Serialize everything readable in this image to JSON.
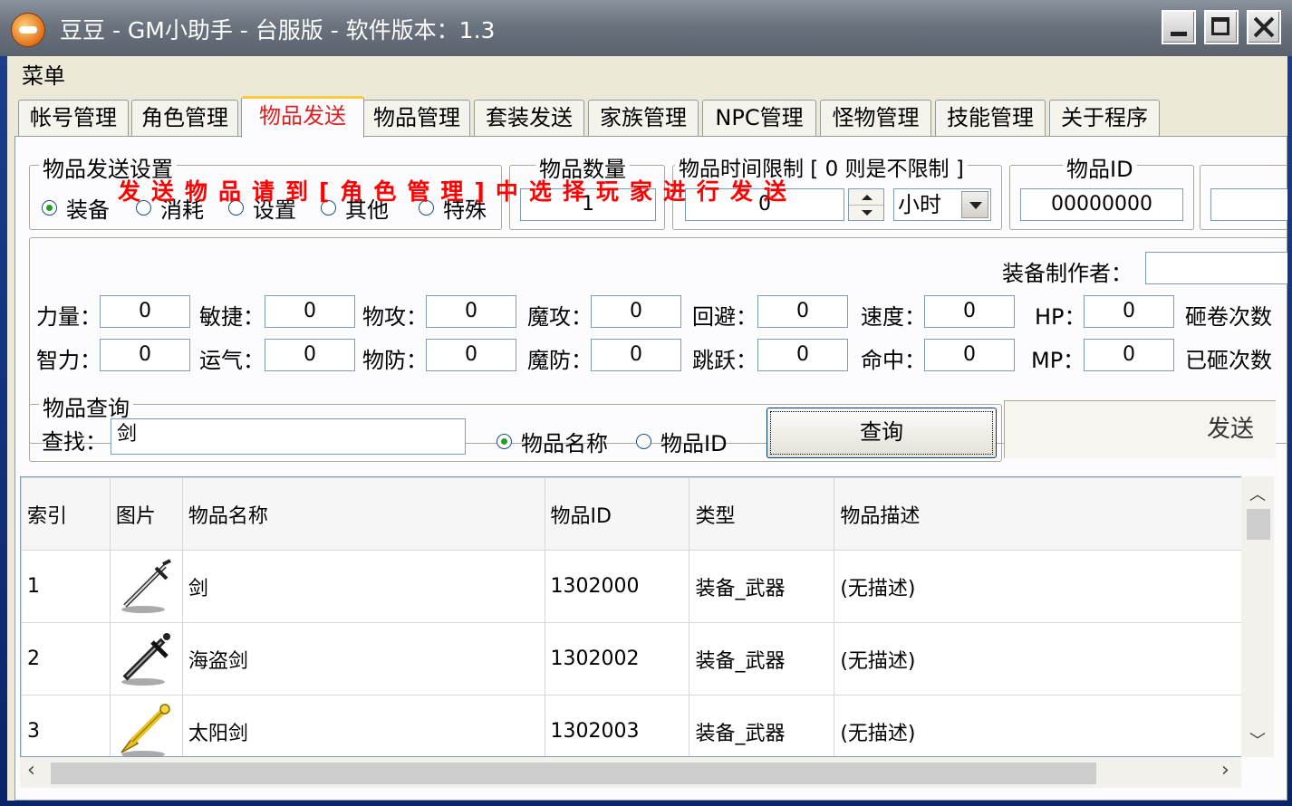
{
  "window": {
    "title": "豆豆 - GM小助手 - 台服版 - 软件版本：1.3"
  },
  "menu": {
    "label": "菜单"
  },
  "tabs": [
    {
      "label": "帐号管理"
    },
    {
      "label": "角色管理"
    },
    {
      "label": "物品发送",
      "active": true
    },
    {
      "label": "物品管理"
    },
    {
      "label": "套装发送"
    },
    {
      "label": "家族管理"
    },
    {
      "label": "NPC管理"
    },
    {
      "label": "怪物管理"
    },
    {
      "label": "技能管理"
    },
    {
      "label": "关于程序"
    }
  ],
  "send_settings": {
    "title": "物品发送设置",
    "options": [
      {
        "label": "装备",
        "selected": true
      },
      {
        "label": "消耗"
      },
      {
        "label": "设置"
      },
      {
        "label": "其他"
      },
      {
        "label": "特殊"
      }
    ]
  },
  "quantity": {
    "title": "物品数量",
    "value": "1"
  },
  "time_limit": {
    "title": "物品时间限制 [ 0 则是不限制 ]",
    "value": "0",
    "unit": "小时"
  },
  "item_id": {
    "title": "物品ID",
    "value": "00000000"
  },
  "notice": "发送物品请到[角色管理]中选择玩家进行发送",
  "maker": {
    "label": "装备制作者：",
    "value": ""
  },
  "stats_row1": [
    {
      "label": "力量：",
      "value": "0"
    },
    {
      "label": "敏捷：",
      "value": "0"
    },
    {
      "label": "物攻：",
      "value": "0"
    },
    {
      "label": "魔攻：",
      "value": "0"
    },
    {
      "label": "回避：",
      "value": "0"
    },
    {
      "label": "速度：",
      "value": "0"
    },
    {
      "label": "HP：",
      "value": "0"
    }
  ],
  "stats_row2": [
    {
      "label": "智力：",
      "value": "0"
    },
    {
      "label": "运气：",
      "value": "0"
    },
    {
      "label": "物防：",
      "value": "0"
    },
    {
      "label": "魔防：",
      "value": "0"
    },
    {
      "label": "跳跃：",
      "value": "0"
    },
    {
      "label": "命中：",
      "value": "0"
    },
    {
      "label": "MP：",
      "value": "0"
    }
  ],
  "extra_labels": {
    "upgrade": "砸卷次数",
    "upgraded": "已砸次数"
  },
  "query": {
    "title": "物品查询",
    "find_label": "查找：",
    "value": "剑",
    "mode_name": "物品名称",
    "mode_id": "物品ID",
    "button": "查询"
  },
  "send_button": "发送",
  "table": {
    "columns": [
      "索引",
      "图片",
      "物品名称",
      "物品ID",
      "类型",
      "物品描述"
    ],
    "rows": [
      {
        "index": "1",
        "icon": "sword-icon",
        "name": "剑",
        "id": "1302000",
        "type": "装备_武器",
        "desc": "(无描述)"
      },
      {
        "index": "2",
        "icon": "pirate-sword-icon",
        "name": "海盗剑",
        "id": "1302002",
        "type": "装备_武器",
        "desc": "(无描述)"
      },
      {
        "index": "3",
        "icon": "sun-sword-icon",
        "name": "太阳剑",
        "id": "1302003",
        "type": "装备_武器",
        "desc": "(无描述)"
      }
    ]
  },
  "colors": {
    "notice": "#ff0000",
    "active_tab_text": "#e02020",
    "tab_highlight": "#ffc83c"
  }
}
